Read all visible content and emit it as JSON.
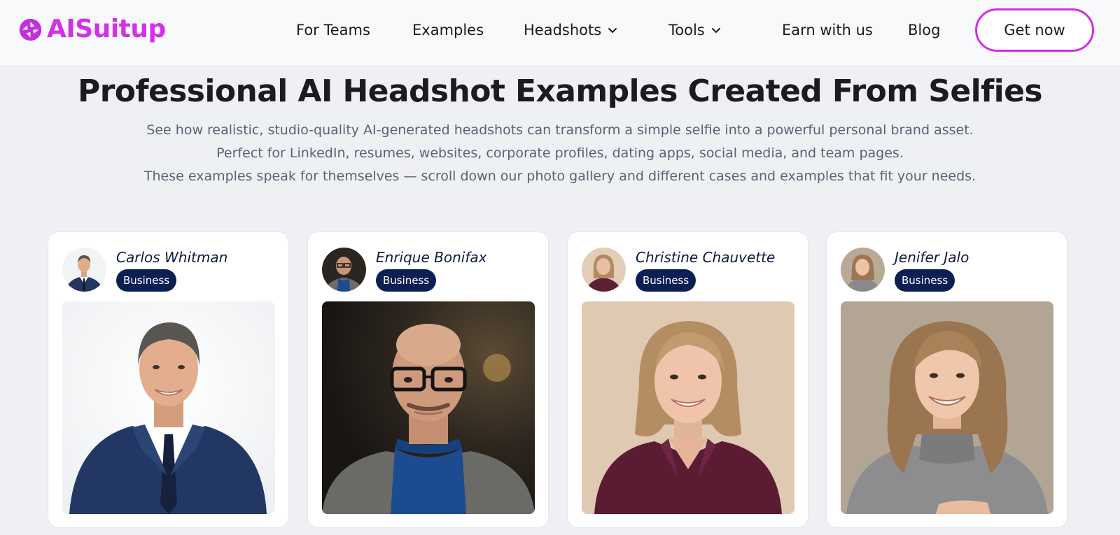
{
  "brand": {
    "name": "AI Suitup",
    "logo_text": "AISuitup",
    "color": "#d232e6"
  },
  "nav": {
    "items": [
      {
        "label": "For Teams"
      },
      {
        "label": "Examples"
      },
      {
        "label": "Headshots",
        "icon": "chevron-down-icon"
      },
      {
        "label": "Tools",
        "icon": "chevron-down-icon"
      },
      {
        "label": "Earn with us"
      },
      {
        "label": "Blog"
      }
    ],
    "cta_label": "Get now"
  },
  "hero": {
    "title": "Professional AI Headshot Examples Created From Selfies",
    "lines": [
      "See how realistic, studio-quality AI-generated headshots can transform a simple selfie into a powerful personal brand asset.",
      "Perfect for LinkedIn, resumes, websites, corporate profiles, dating apps, social media, and team pages.",
      "These examples speak for themselves — scroll down our photo gallery and different cases and examples that fit your needs."
    ]
  },
  "examples": [
    {
      "name": "Carlos Whitman",
      "tag": "Business",
      "photo": "headshot-man-navy-suit"
    },
    {
      "name": "Enrique Bonifax",
      "tag": "Business",
      "photo": "headshot-bald-man-glasses-turtleneck"
    },
    {
      "name": "Christine Chauvette",
      "tag": "Business",
      "photo": "headshot-woman-burgundy-blouse"
    },
    {
      "name": "Jenifer Jalo",
      "tag": "Business",
      "photo": "headshot-woman-gray-turtleneck"
    }
  ],
  "colors": {
    "accent": "#cf2fe3",
    "badge_bg": "#0b1f52",
    "page_bg": "#eef0f4",
    "nav_bg": "#f8f9fb"
  }
}
